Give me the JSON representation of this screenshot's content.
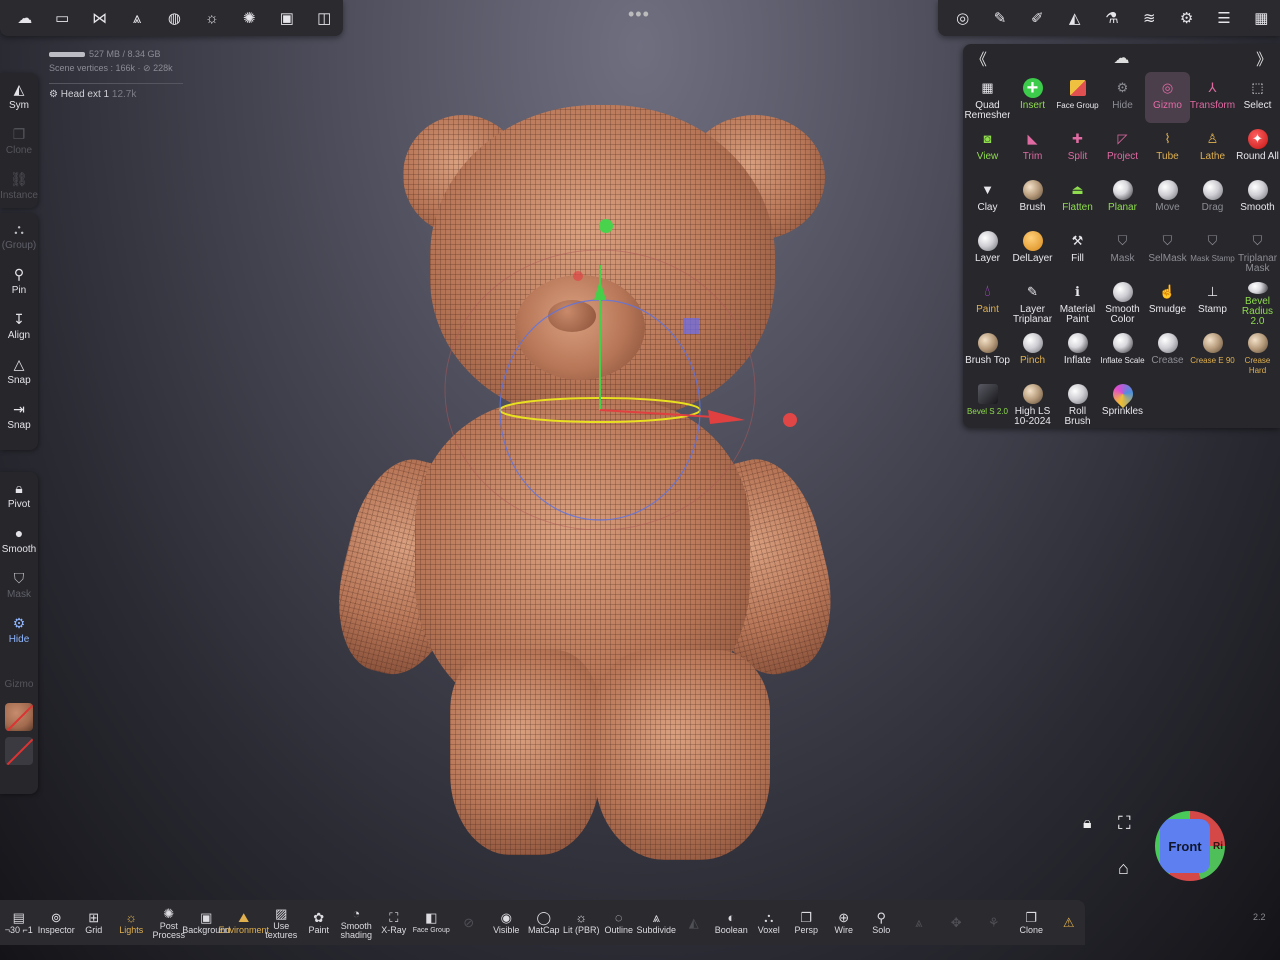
{
  "top_left_toolbar": [
    {
      "icon": "nomad-logo-icon",
      "glyph": "☁"
    },
    {
      "icon": "folder-icon",
      "glyph": "▭"
    },
    {
      "icon": "scene-graph-icon",
      "glyph": "⋈"
    },
    {
      "icon": "layers-mesh-icon",
      "glyph": "⩓"
    },
    {
      "icon": "material-sphere-icon",
      "glyph": "◍"
    },
    {
      "icon": "lighting-sun-icon",
      "glyph": "☼"
    },
    {
      "icon": "postprocess-icon",
      "glyph": "✺"
    },
    {
      "icon": "background-image-icon",
      "glyph": "▣"
    },
    {
      "icon": "camera-icon",
      "glyph": "◫"
    }
  ],
  "top_right_toolbar": [
    {
      "icon": "gizmo-cursor-icon",
      "glyph": "◎"
    },
    {
      "icon": "brush-pen-icon",
      "glyph": "✎"
    },
    {
      "icon": "eyedropper-icon",
      "glyph": "✐"
    },
    {
      "icon": "symmetry-icon",
      "glyph": "◭"
    },
    {
      "icon": "flask-icon",
      "glyph": "⚗"
    },
    {
      "icon": "stack-layers-icon",
      "glyph": "≋"
    },
    {
      "icon": "settings-gear-icon",
      "glyph": "⚙"
    },
    {
      "icon": "sliders-icon",
      "glyph": "☰"
    },
    {
      "icon": "interface-icon",
      "glyph": "▦"
    }
  ],
  "scene_info": {
    "memory": "527 MB / 8.34 GB",
    "vertices": "Scene vertices : 166k · ⊘ 228k",
    "layer_name": "Head ext 1",
    "layer_count": "12.7k"
  },
  "left_toolbar_group1": [
    {
      "icon": "symmetry-icon",
      "glyph": "◭",
      "label": "Sym",
      "state": "normal"
    },
    {
      "icon": "clone-icon",
      "glyph": "❐",
      "label": "Clone",
      "state": "dim"
    },
    {
      "icon": "instance-link-icon",
      "glyph": "⛓",
      "label": "Instance",
      "state": "dim"
    }
  ],
  "left_toolbar_group2": [
    {
      "icon": "group-nodes-icon",
      "glyph": "⛬",
      "label": "(Group)",
      "state": "dim-label"
    },
    {
      "icon": "pin-icon",
      "glyph": "⚲",
      "label": "Pin",
      "state": "normal"
    },
    {
      "icon": "align-icon",
      "glyph": "↧",
      "label": "Align",
      "state": "normal"
    },
    {
      "icon": "snap-angle-icon",
      "glyph": "△",
      "label": "Snap",
      "state": "normal"
    },
    {
      "icon": "snap-arrow-icon",
      "glyph": "⇥",
      "label": "Snap",
      "state": "normal"
    }
  ],
  "left_toolbar_group3": [
    {
      "icon": "lock-pivot-icon",
      "glyph": "🔒︎",
      "label": "Pivot",
      "state": "normal"
    },
    {
      "icon": "smooth-sphere-icon",
      "glyph": "●",
      "label": "Smooth",
      "state": "normal"
    },
    {
      "icon": "mask-shield-icon",
      "glyph": "⛉",
      "label": "Mask",
      "state": "dim-label"
    },
    {
      "icon": "hide-icon",
      "glyph": "⚙",
      "label": "Hide",
      "state": "blue"
    },
    {
      "icon": "gizmo-icon",
      "glyph": "",
      "label": "Gizmo",
      "state": "dim"
    }
  ],
  "swatches": {
    "material_color": "#a26a4e",
    "second_color": "#3a3a40"
  },
  "tools_panel": {
    "collapse_glyph": "《",
    "expand_glyph": "》",
    "logo_glyph": "☁",
    "tools": [
      {
        "label": "Quad Remesher",
        "icon": "quad-remesher-icon",
        "glyph": "▦",
        "style": "normal",
        "ic": "plain"
      },
      {
        "label": "Insert",
        "icon": "insert-plus-icon",
        "glyph": "+",
        "style": "green",
        "ic": "green"
      },
      {
        "label": "Face Group",
        "icon": "face-group-icon",
        "glyph": "◧",
        "style": "tiny",
        "ic": "facegroup"
      },
      {
        "label": "Hide",
        "icon": "hide-icon",
        "glyph": "⚙",
        "style": "gray",
        "ic": "plain"
      },
      {
        "label": "Gizmo",
        "icon": "gizmo-icon",
        "glyph": "◎",
        "style": "active",
        "ic": "plain"
      },
      {
        "label": "Transform",
        "icon": "transform-axes-icon",
        "glyph": "⅄",
        "style": "pink",
        "ic": "plain"
      },
      {
        "label": "Select",
        "icon": "select-icon",
        "glyph": "⬚",
        "style": "normal",
        "ic": "plain"
      },
      {
        "label": "View",
        "icon": "view-camera-icon",
        "glyph": "◙",
        "style": "green",
        "ic": "plain"
      },
      {
        "label": "Trim",
        "icon": "trim-icon",
        "glyph": "◣",
        "style": "pink",
        "ic": "plain"
      },
      {
        "label": "Split",
        "icon": "split-icon",
        "glyph": "✚",
        "style": "pink",
        "ic": "plain"
      },
      {
        "label": "Project",
        "icon": "project-icon",
        "glyph": "◸",
        "style": "pink",
        "ic": "plain"
      },
      {
        "label": "Tube",
        "icon": "tube-icon",
        "glyph": "⌇",
        "style": "gold",
        "ic": "plain"
      },
      {
        "label": "Lathe",
        "icon": "lathe-icon",
        "glyph": "♙",
        "style": "gold",
        "ic": "plain"
      },
      {
        "label": "Round All",
        "icon": "round-all-icon",
        "glyph": "✦",
        "style": "normal",
        "ic": "red"
      },
      {
        "label": "Clay",
        "icon": "clay-trowel-icon",
        "glyph": "▼",
        "style": "normal",
        "ic": "plain"
      },
      {
        "label": "Brush",
        "icon": "brush-sphere-icon",
        "glyph": "",
        "style": "normal",
        "ic": "tan"
      },
      {
        "label": "Flatten",
        "icon": "flatten-iron-icon",
        "glyph": "⏏",
        "style": "green",
        "ic": "plain"
      },
      {
        "label": "Planar",
        "icon": "planar-sphere-icon",
        "glyph": "",
        "style": "green",
        "ic": "dk"
      },
      {
        "label": "Move",
        "icon": "move-sphere-icon",
        "glyph": "",
        "style": "gray",
        "ic": "sphere"
      },
      {
        "label": "Drag",
        "icon": "drag-sphere-icon",
        "glyph": "",
        "style": "gray",
        "ic": "sphere"
      },
      {
        "label": "Smooth",
        "icon": "smooth-sphere-icon",
        "glyph": "",
        "style": "normal",
        "ic": "sphere"
      },
      {
        "label": "Layer",
        "icon": "layer-sphere-icon",
        "glyph": "",
        "style": "normal",
        "ic": "sphere"
      },
      {
        "label": "DelLayer",
        "icon": "dellayer-sphere-icon",
        "glyph": "",
        "style": "normal",
        "ic": "orange"
      },
      {
        "label": "Fill",
        "icon": "fill-icon",
        "glyph": "⚒",
        "style": "normal",
        "ic": "plain"
      },
      {
        "label": "Mask",
        "icon": "mask-shield-icon",
        "glyph": "⛉",
        "style": "gray",
        "ic": "plain"
      },
      {
        "label": "SelMask",
        "icon": "selmask-shield-icon",
        "glyph": "⛉",
        "style": "gray",
        "ic": "plain"
      },
      {
        "label": "Mask Stamp",
        "icon": "mask-stamp-icon",
        "glyph": "⛉",
        "style": "gray tiny",
        "ic": "plain"
      },
      {
        "label": "Triplanar Mask",
        "icon": "triplanar-mask-icon",
        "glyph": "⛉",
        "style": "gray",
        "ic": "plain"
      },
      {
        "label": "Paint",
        "icon": "paint-drop-icon",
        "glyph": "💧︎",
        "style": "gold",
        "ic": "paint"
      },
      {
        "label": "Layer Triplanar",
        "icon": "layer-triplanar-icon",
        "glyph": "✎",
        "style": "normal",
        "ic": "plain"
      },
      {
        "label": "Material Paint",
        "icon": "material-paint-icon",
        "glyph": "ℹ",
        "style": "normal",
        "ic": "plain"
      },
      {
        "label": "Smooth Color",
        "icon": "smooth-color-icon",
        "glyph": "",
        "style": "normal",
        "ic": "sphere"
      },
      {
        "label": "Smudge",
        "icon": "smudge-icon",
        "glyph": "☝",
        "style": "normal",
        "ic": "plain"
      },
      {
        "label": "Stamp",
        "icon": "stamp-icon",
        "glyph": "⊥",
        "style": "normal",
        "ic": "plain"
      },
      {
        "label": "Bevel Radius 2.0",
        "icon": "bevel-radius-icon",
        "glyph": "",
        "style": "green",
        "ic": "dk"
      },
      {
        "label": "Brush Top",
        "icon": "brush-top-icon",
        "glyph": "",
        "style": "normal",
        "ic": "tan"
      },
      {
        "label": "Pinch",
        "icon": "pinch-icon",
        "glyph": "",
        "style": "gold",
        "ic": "sphere"
      },
      {
        "label": "Inflate",
        "icon": "inflate-icon",
        "glyph": "",
        "style": "normal",
        "ic": "dk"
      },
      {
        "label": "Inflate Scale",
        "icon": "inflate-scale-icon",
        "glyph": "",
        "style": "tiny",
        "ic": "dk"
      },
      {
        "label": "Crease",
        "icon": "crease-icon",
        "glyph": "",
        "style": "gray",
        "ic": "sphere"
      },
      {
        "label": "Crease E 90",
        "icon": "crease-e90-icon",
        "glyph": "",
        "style": "gold tiny",
        "ic": "tan"
      },
      {
        "label": "Crease Hard",
        "icon": "crease-hard-icon",
        "glyph": "",
        "style": "gold tiny",
        "ic": "tan"
      },
      {
        "label": "Bevel S 2.0",
        "icon": "bevel-s-icon",
        "glyph": "",
        "style": "green tiny",
        "ic": "cube"
      },
      {
        "label": "High LS 10-2024",
        "icon": "high-ls-icon",
        "glyph": "",
        "style": "normal",
        "ic": "tan"
      },
      {
        "label": "Roll Brush",
        "icon": "roll-brush-icon",
        "glyph": "",
        "style": "normal",
        "ic": "sphere"
      },
      {
        "label": "Sprinkles",
        "icon": "sprinkles-icon",
        "glyph": "",
        "style": "normal",
        "ic": "sprinkle"
      }
    ]
  },
  "bottom_toolbar": [
    {
      "label": "¬30 ⌐1",
      "icon": "stats-icon",
      "glyph": "▤",
      "style": "normal"
    },
    {
      "label": "Inspector",
      "icon": "inspector-icon",
      "glyph": "⊚",
      "style": "normal"
    },
    {
      "label": "Grid",
      "icon": "grid-icon",
      "glyph": "⊞",
      "style": "normal"
    },
    {
      "label": "Lights",
      "icon": "lights-icon",
      "glyph": "☼",
      "style": "gold"
    },
    {
      "label": "Post Process",
      "icon": "postprocess-icon",
      "glyph": "✺",
      "style": "normal"
    },
    {
      "label": "Background",
      "icon": "background-icon",
      "glyph": "▣",
      "style": "normal"
    },
    {
      "label": "Environment",
      "icon": "environment-icon",
      "glyph": "⛰",
      "style": "gold"
    },
    {
      "label": "Use textures",
      "icon": "textures-icon",
      "glyph": "▨",
      "style": "normal"
    },
    {
      "label": "Paint",
      "icon": "paint-palette-icon",
      "glyph": "✿",
      "style": "normal"
    },
    {
      "label": "Smooth shading",
      "icon": "smooth-shading-icon",
      "glyph": "◔",
      "style": "normal"
    },
    {
      "label": "X-Ray",
      "icon": "xray-glasses-icon",
      "glyph": "⛶",
      "style": "normal"
    },
    {
      "label": "Face Group",
      "icon": "face-group-icon",
      "glyph": "◧",
      "style": "tiny"
    },
    {
      "label": "",
      "icon": "disabled-icon",
      "glyph": "⊘",
      "style": "dim"
    },
    {
      "label": "Visible",
      "icon": "eye-icon",
      "glyph": "◉",
      "style": "normal"
    },
    {
      "label": "MatCap",
      "icon": "matcap-icon",
      "glyph": "◯",
      "style": "normal"
    },
    {
      "label": "Lit (PBR)",
      "icon": "lit-sun-icon",
      "glyph": "☼",
      "style": "normal"
    },
    {
      "label": "Outline",
      "icon": "outline-icon",
      "glyph": "◌",
      "style": "normal"
    },
    {
      "label": "Subdivide",
      "icon": "subdivide-icon",
      "glyph": "⩓",
      "style": "normal"
    },
    {
      "label": "",
      "icon": "disabled-mesh-icon",
      "glyph": "◭",
      "style": "dim"
    },
    {
      "label": "Boolean",
      "icon": "boolean-icon",
      "glyph": "◐",
      "style": "normal"
    },
    {
      "label": "Voxel",
      "icon": "voxel-icon",
      "glyph": "⛬",
      "style": "normal"
    },
    {
      "label": "Persp",
      "icon": "persp-icon",
      "glyph": "❐",
      "style": "normal"
    },
    {
      "label": "Wire",
      "icon": "wire-icon",
      "glyph": "⊕",
      "style": "normal"
    },
    {
      "label": "Solo",
      "icon": "solo-search-icon",
      "glyph": "⚲",
      "style": "normal"
    },
    {
      "label": "",
      "icon": "disabled-front-icon",
      "glyph": "⩓",
      "style": "dim"
    },
    {
      "label": "",
      "icon": "disabled-transform-icon",
      "glyph": "✥",
      "style": "dim"
    },
    {
      "label": "",
      "icon": "disabled-link-icon",
      "glyph": "⚘",
      "style": "dim"
    },
    {
      "label": "Clone",
      "icon": "clone-icon",
      "glyph": "❐",
      "style": "normal"
    },
    {
      "label": "",
      "icon": "warning-icon",
      "glyph": "⚠",
      "style": "gold"
    }
  ],
  "version": "2.2",
  "view_cube": {
    "front_label": "Front",
    "side_label": "Ri"
  },
  "colors": {
    "accent_pink": "#e66aa8",
    "accent_green": "#8fdc4e",
    "accent_gold": "#e0b04f",
    "model_clay": "#b77657",
    "toolbar_bg": "#2a2a2f"
  }
}
